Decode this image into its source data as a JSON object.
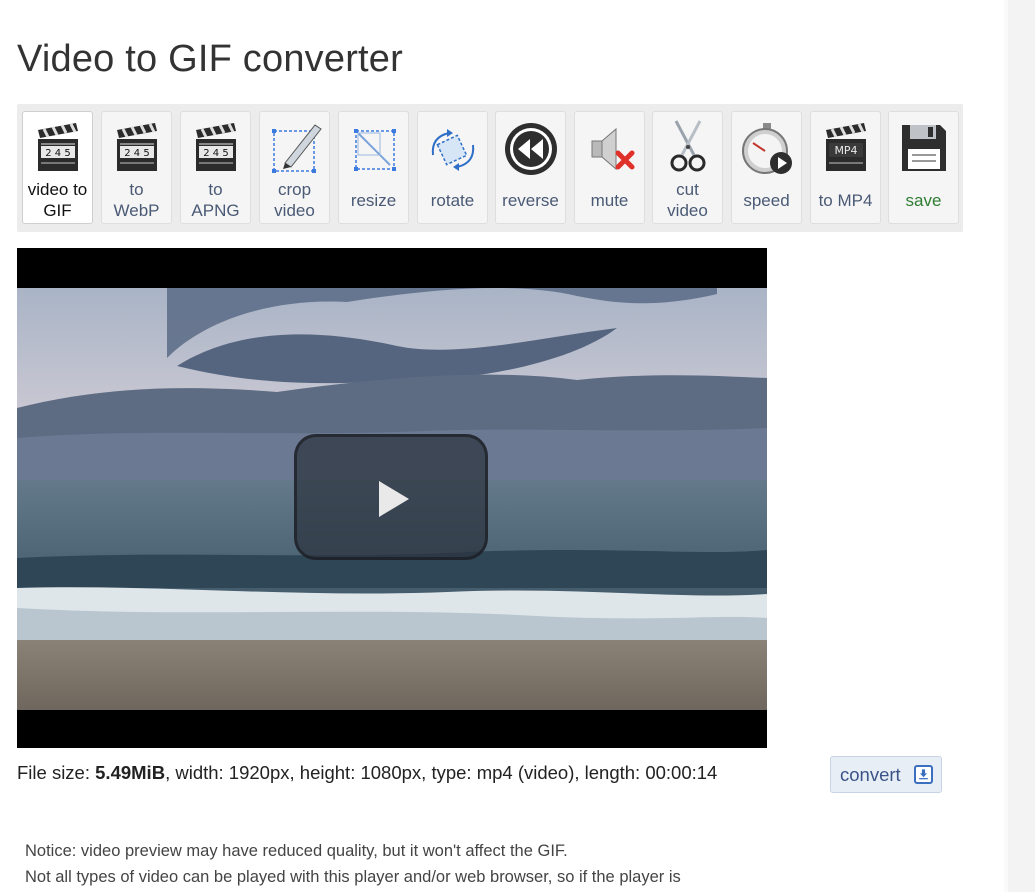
{
  "page": {
    "title": "Video to GIF converter"
  },
  "toolbar": {
    "tools": [
      {
        "label": "video to GIF",
        "line1": "video to",
        "line2": "GIF",
        "active": true
      },
      {
        "label": "to WebP",
        "line1": "to",
        "line2": "WebP"
      },
      {
        "label": "to APNG",
        "line1": "to",
        "line2": "APNG"
      },
      {
        "label": "crop video",
        "line1": "crop",
        "line2": "video"
      },
      {
        "label": "resize"
      },
      {
        "label": "rotate"
      },
      {
        "label": "reverse"
      },
      {
        "label": "mute"
      },
      {
        "label": "cut video",
        "line1": "cut",
        "line2": "video"
      },
      {
        "label": "speed"
      },
      {
        "label": "to MP4"
      },
      {
        "label": "save"
      }
    ],
    "clapper_digits": "2 4 5",
    "mp4_text": "MP4"
  },
  "file_info": {
    "size_label": "File size:",
    "size_value": "5.49MiB",
    "rest": ", width: 1920px, height: 1080px, type: mp4 (video), length: 00:00:14"
  },
  "convert_button": {
    "label": "convert"
  },
  "notice": {
    "line1": "Notice: video preview may have reduced quality, but it won't affect the GIF.",
    "line2": "Not all types of video can be played with this player and/or web browser, so if the player is"
  },
  "colors": {
    "accent": "#3b6fc0",
    "save_green": "#2e7d32",
    "label_blue": "#4a5a75"
  },
  "icons": [
    "clapperboard-icon",
    "clapperboard-icon",
    "clapperboard-icon",
    "crop-icon",
    "resize-icon",
    "rotate-icon",
    "rewind-icon",
    "mute-icon",
    "scissors-icon",
    "stopwatch-icon",
    "mp4-clapperboard-icon",
    "floppy-disk-icon",
    "play-icon",
    "download-icon"
  ]
}
